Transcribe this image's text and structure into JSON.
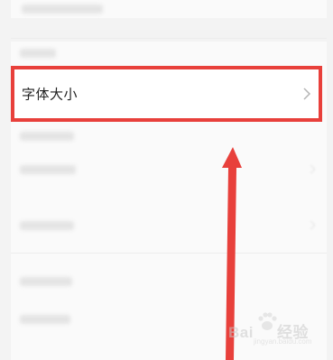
{
  "settings_list": {
    "highlighted_item": {
      "label": "字体大小",
      "chevron_icon": "chevron-right-icon"
    }
  },
  "annotation": {
    "highlight_color": "#e8403b",
    "arrow_color": "#e8403b"
  },
  "watermark": {
    "brand": "Bai",
    "brand_cn": "经验",
    "url": "jingyan.baidu.com",
    "icon": "paw-icon"
  }
}
